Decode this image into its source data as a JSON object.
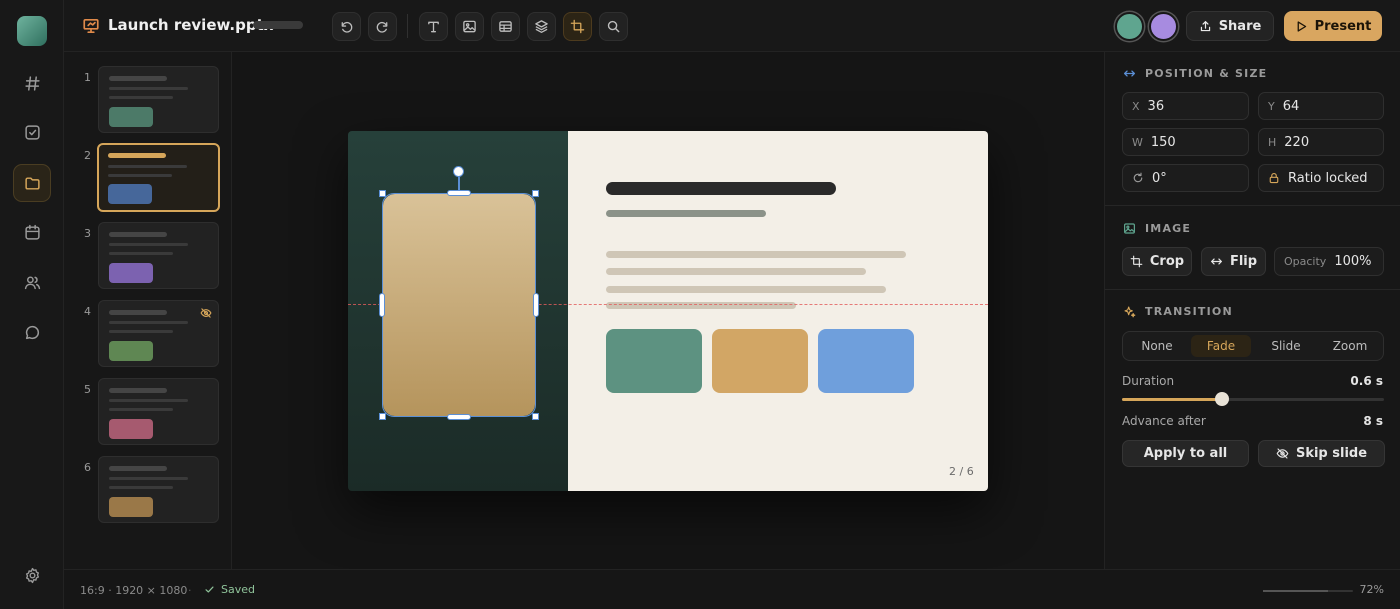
{
  "app": {
    "title": "Launch review.pptx",
    "nav": [
      "hash-icon",
      "checklist-icon",
      "folder-icon",
      "calendar-icon",
      "users-icon",
      "chat-icon"
    ],
    "active_nav": "folder-icon",
    "settings_icon": "gear-icon"
  },
  "toolbar": {
    "tools": [
      "undo-icon",
      "redo-icon",
      "text-icon",
      "image-icon",
      "table-icon",
      "layers-icon",
      "crop-icon",
      "search-icon"
    ],
    "active_tool": "crop-icon",
    "share_label": "Share",
    "present_label": "Present",
    "collaborator_colors": [
      "#5fa58f",
      "#a78be0"
    ]
  },
  "slides": [
    {
      "number": "1",
      "color": "#4c7a68",
      "hidden": false,
      "active": false
    },
    {
      "number": "2",
      "color": "#46679a",
      "hidden": false,
      "active": true
    },
    {
      "number": "3",
      "color": "#7c62b0",
      "hidden": false,
      "active": false
    },
    {
      "number": "4",
      "color": "#5f8753",
      "hidden": true,
      "active": false
    },
    {
      "number": "5",
      "color": "#a65a6f",
      "hidden": false,
      "active": false
    },
    {
      "number": "6",
      "color": "#9a7848",
      "hidden": false,
      "active": false
    }
  ],
  "canvas": {
    "page_indicator": "2 / 6",
    "card_colors": [
      "#5d9281",
      "#d2a665",
      "#6f9fdc"
    ]
  },
  "properties": {
    "position_size": {
      "heading": "POSITION & SIZE",
      "x_label": "X",
      "x": "36",
      "y_label": "Y",
      "y": "64",
      "w_label": "W",
      "w": "150",
      "h_label": "H",
      "h": "220",
      "rotation": "0°",
      "ratio": "Ratio locked"
    },
    "image": {
      "heading": "IMAGE",
      "crop_label": "Crop",
      "flip_label": "Flip",
      "opacity_label": "Opacity",
      "opacity": "100%"
    },
    "transition": {
      "heading": "TRANSITION",
      "options": [
        "None",
        "Fade",
        "Slide",
        "Zoom"
      ],
      "active": "Fade",
      "duration_label": "Duration",
      "duration": "0.6 s",
      "duration_fraction": 0.38,
      "advance_label": "Advance after",
      "advance": "8 s",
      "apply_label": "Apply to all",
      "skip_label": "Skip slide"
    }
  },
  "status": {
    "dimensions": "16:9 · 1920 × 1080",
    "separator": "·",
    "saved": "Saved",
    "zoom": "72%",
    "zoom_fraction": 0.72
  }
}
